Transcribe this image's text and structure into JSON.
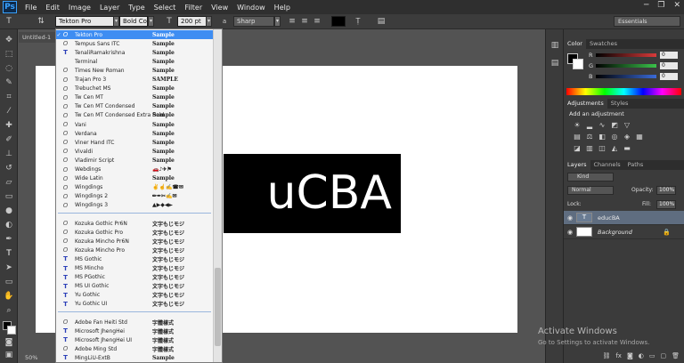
{
  "menubar": {
    "logo": "Ps",
    "items": [
      "File",
      "Edit",
      "Image",
      "Layer",
      "Type",
      "Select",
      "Filter",
      "View",
      "Window",
      "Help"
    ],
    "win_minimize": "─",
    "win_restore": "❐",
    "win_close": "✕"
  },
  "options_bar": {
    "font_family": "Tekton Pro",
    "font_style": "Bold Co...",
    "font_size": "200 pt",
    "antialias": "Sharp",
    "text_color": "#000000",
    "workspace": "Essentials"
  },
  "document": {
    "tab_title": "Untitled-1",
    "zoom": "50%",
    "text": "uCBA"
  },
  "font_dropdown": {
    "selected_index": 0,
    "groups": [
      [
        {
          "name": "Tekton Pro",
          "sample": "Sample",
          "icon": "O"
        },
        {
          "name": "Tempus Sans ITC",
          "sample": "Sample",
          "icon": "O"
        },
        {
          "name": "TenaliRamakrishna",
          "sample": "Sample",
          "icon": "TT"
        },
        {
          "name": "Terminal",
          "sample": "Sample",
          "icon": ""
        },
        {
          "name": "Times New Roman",
          "sample": "Sample",
          "icon": "O"
        },
        {
          "name": "Trajan Pro 3",
          "sample": "SAMPLE",
          "icon": "O"
        },
        {
          "name": "Trebuchet MS",
          "sample": "Sample",
          "icon": "O"
        },
        {
          "name": "Tw Cen MT",
          "sample": "Sample",
          "icon": "O"
        },
        {
          "name": "Tw Cen MT Condensed",
          "sample": "Sample",
          "icon": "O"
        },
        {
          "name": "Tw Cen MT Condensed Extra Bold",
          "sample": "Sample",
          "icon": "O"
        },
        {
          "name": "Vani",
          "sample": "Sample",
          "icon": "O"
        },
        {
          "name": "Verdana",
          "sample": "Sample",
          "icon": "O"
        },
        {
          "name": "Viner Hand ITC",
          "sample": "Sample",
          "icon": "O"
        },
        {
          "name": "Vivaldi",
          "sample": "Sample",
          "icon": "O"
        },
        {
          "name": "Vladimir Script",
          "sample": "Sample",
          "icon": "O"
        },
        {
          "name": "Webdings",
          "sample": "🚗♪✈⚑",
          "icon": "O"
        },
        {
          "name": "Wide Latin",
          "sample": "Sample",
          "icon": "O"
        },
        {
          "name": "Wingdings",
          "sample": "✌☝✍☎✉",
          "icon": "O"
        },
        {
          "name": "Wingdings 2",
          "sample": "✏✒✂✍✉",
          "icon": "O"
        },
        {
          "name": "Wingdings 3",
          "sample": "▲▶◆◀►",
          "icon": "O"
        }
      ],
      [
        {
          "name": "Kozuka Gothic Pr6N",
          "sample": "文字もじモジ",
          "icon": "O"
        },
        {
          "name": "Kozuka Gothic Pro",
          "sample": "文字もじモジ",
          "icon": "O"
        },
        {
          "name": "Kozuka Mincho Pr6N",
          "sample": "文字もじモジ",
          "icon": "O"
        },
        {
          "name": "Kozuka Mincho Pro",
          "sample": "文字もじモジ",
          "icon": "O"
        },
        {
          "name": "MS Gothic",
          "sample": "文字もじモジ",
          "icon": "TT"
        },
        {
          "name": "MS Mincho",
          "sample": "文字もじモジ",
          "icon": "TT"
        },
        {
          "name": "MS PGothic",
          "sample": "文字もじモジ",
          "icon": "TT"
        },
        {
          "name": "MS UI Gothic",
          "sample": "文字もじモジ",
          "icon": "TT"
        },
        {
          "name": "Yu Gothic",
          "sample": "文字もじモジ",
          "icon": "TT"
        },
        {
          "name": "Yu Gothic UI",
          "sample": "文字もじモジ",
          "icon": "TT"
        }
      ],
      [
        {
          "name": "Adobe Fan Heiti Std",
          "sample": "字體樣式",
          "icon": "O"
        },
        {
          "name": "Microsoft JhengHei",
          "sample": "字體樣式",
          "icon": "TT"
        },
        {
          "name": "Microsoft JhengHei UI",
          "sample": "字體樣式",
          "icon": "TT"
        },
        {
          "name": "Adobe Ming Std",
          "sample": "字體樣式",
          "icon": "O"
        },
        {
          "name": "MingLiU-ExtB",
          "sample": "Sample",
          "icon": "TT"
        }
      ]
    ]
  },
  "color_panel": {
    "tabs": [
      "Color",
      "Swatches"
    ],
    "sliders": [
      {
        "label": "R",
        "value": "0",
        "color": "#d83a3a"
      },
      {
        "label": "G",
        "value": "0",
        "color": "#3ac24a"
      },
      {
        "label": "B",
        "value": "0",
        "color": "#3a6ad8"
      }
    ]
  },
  "adjustments_panel": {
    "tabs": [
      "Adjustments",
      "Styles"
    ],
    "title": "Add an adjustment"
  },
  "layers_panel": {
    "tabs": [
      "Layers",
      "Channels",
      "Paths"
    ],
    "kind_filter": "Kind",
    "blend_mode": "Normal",
    "opacity_label": "Opacity:",
    "opacity": "100%",
    "lock_label": "Lock:",
    "fill_label": "Fill:",
    "fill": "100%",
    "layers": [
      {
        "name": "educBA",
        "type": "text"
      },
      {
        "name": "Background",
        "type": "raster"
      }
    ]
  },
  "watermark": {
    "title": "Activate Windows",
    "subtitle": "Go to Settings to activate Windows."
  }
}
